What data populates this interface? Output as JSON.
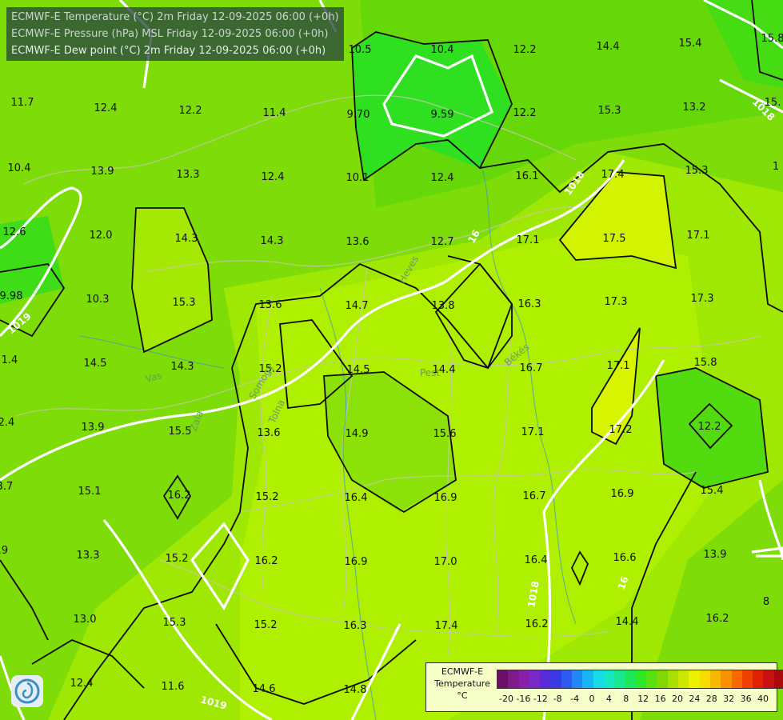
{
  "titles": [
    "ECMWF-E Temperature (°C) 2m Friday 12-09-2025 06:00 (+0h)",
    "ECMWF-E Pressure (hPa) MSL Friday 12-09-2025 06:00 (+0h)",
    "ECMWF-E Dew point (°C) 2m Friday 12-09-2025 06:00 (+0h)"
  ],
  "legend": {
    "title_lines": [
      "ECMWF-E",
      "Temperature",
      "°C"
    ],
    "ticks": [
      "-20",
      "-16",
      "-12",
      "-8",
      "-4",
      "0",
      "4",
      "8",
      "12",
      "16",
      "20",
      "24",
      "28",
      "32",
      "36",
      "40"
    ],
    "colors": [
      "#6b0f6b",
      "#7e1a8a",
      "#8a1fa8",
      "#7a28c8",
      "#5a2cd8",
      "#3a3ae6",
      "#2a5cf0",
      "#1f88f5",
      "#19b5f3",
      "#16dbe6",
      "#15e8c0",
      "#18e890",
      "#1ee85a",
      "#2ee828",
      "#58e010",
      "#80d800",
      "#a8e000",
      "#cce800",
      "#eef000",
      "#f8dc00",
      "#f8b800",
      "#f89000",
      "#f86800",
      "#f04000",
      "#e02000",
      "#c81010",
      "#a80808",
      "#880808",
      "#6a0606"
    ]
  },
  "temperature_labels": [
    {
      "v": "10.5"
    },
    {
      "v": "10.4"
    },
    {
      "v": "12.2"
    },
    {
      "v": "14.4"
    },
    {
      "v": "15.4"
    },
    {
      "v": "15.8"
    },
    {
      "v": "11.7"
    },
    {
      "v": "12.4"
    },
    {
      "v": "12.2"
    },
    {
      "v": "11.4"
    },
    {
      "v": "9.70"
    },
    {
      "v": "9.59"
    },
    {
      "v": "12.2"
    },
    {
      "v": "15.3"
    },
    {
      "v": "13.2"
    },
    {
      "v": "15."
    },
    {
      "v": "10.4"
    },
    {
      "v": "13.9"
    },
    {
      "v": "13.3"
    },
    {
      "v": "12.4"
    },
    {
      "v": "10.1"
    },
    {
      "v": "12.4"
    },
    {
      "v": "16.1"
    },
    {
      "v": "17.4"
    },
    {
      "v": "15.3"
    },
    {
      "v": "1"
    },
    {
      "v": "12.6"
    },
    {
      "v": "12.0"
    },
    {
      "v": "14.3"
    },
    {
      "v": "14.3"
    },
    {
      "v": "13.6"
    },
    {
      "v": "12.7"
    },
    {
      "v": "17.1"
    },
    {
      "v": "17.5"
    },
    {
      "v": "17.1"
    },
    {
      "v": "9.98"
    },
    {
      "v": "10.3"
    },
    {
      "v": "15.3"
    },
    {
      "v": "13.6"
    },
    {
      "v": "14.7"
    },
    {
      "v": "13.8"
    },
    {
      "v": "16.3"
    },
    {
      "v": "17.3"
    },
    {
      "v": "17.3"
    },
    {
      "v": "1.4"
    },
    {
      "v": "14.5"
    },
    {
      "v": "14.3"
    },
    {
      "v": "15.2"
    },
    {
      "v": "14.5"
    },
    {
      "v": "14.4"
    },
    {
      "v": "16.7"
    },
    {
      "v": "17.1"
    },
    {
      "v": "15.8"
    },
    {
      "v": "2.4"
    },
    {
      "v": "13.9"
    },
    {
      "v": "15.5"
    },
    {
      "v": "13.6"
    },
    {
      "v": "14.9"
    },
    {
      "v": "15.6"
    },
    {
      "v": "17.1"
    },
    {
      "v": "17.2"
    },
    {
      "v": "12.2"
    },
    {
      "v": "3.7"
    },
    {
      "v": "15.1"
    },
    {
      "v": "16.2"
    },
    {
      "v": "15.2"
    },
    {
      "v": "16.4"
    },
    {
      "v": "16.9"
    },
    {
      "v": "16.7"
    },
    {
      "v": "16.9"
    },
    {
      "v": "15.4"
    },
    {
      "v": ".9"
    },
    {
      "v": "13.3"
    },
    {
      "v": "15.2"
    },
    {
      "v": "16.2"
    },
    {
      "v": "16.9"
    },
    {
      "v": "17.0"
    },
    {
      "v": "16.4"
    },
    {
      "v": "16.6"
    },
    {
      "v": "13.9"
    },
    {
      "v": "13.0"
    },
    {
      "v": "15.3"
    },
    {
      "v": "15.2"
    },
    {
      "v": "16.3"
    },
    {
      "v": "17.4"
    },
    {
      "v": "16.2"
    },
    {
      "v": "14.4"
    },
    {
      "v": "16.2"
    },
    {
      "v": "12.4"
    },
    {
      "v": "11.6"
    },
    {
      "v": "14.6"
    },
    {
      "v": "14.8"
    },
    {
      "v": "8"
    }
  ],
  "pressure_labels": [
    "1019",
    "1018",
    "1018",
    "1018",
    "1019",
    "16",
    "16"
  ],
  "region_labels": [
    "Heves",
    "Békés",
    "Pest",
    "Vas",
    "Zala",
    "Tolna",
    "Somogy"
  ]
}
